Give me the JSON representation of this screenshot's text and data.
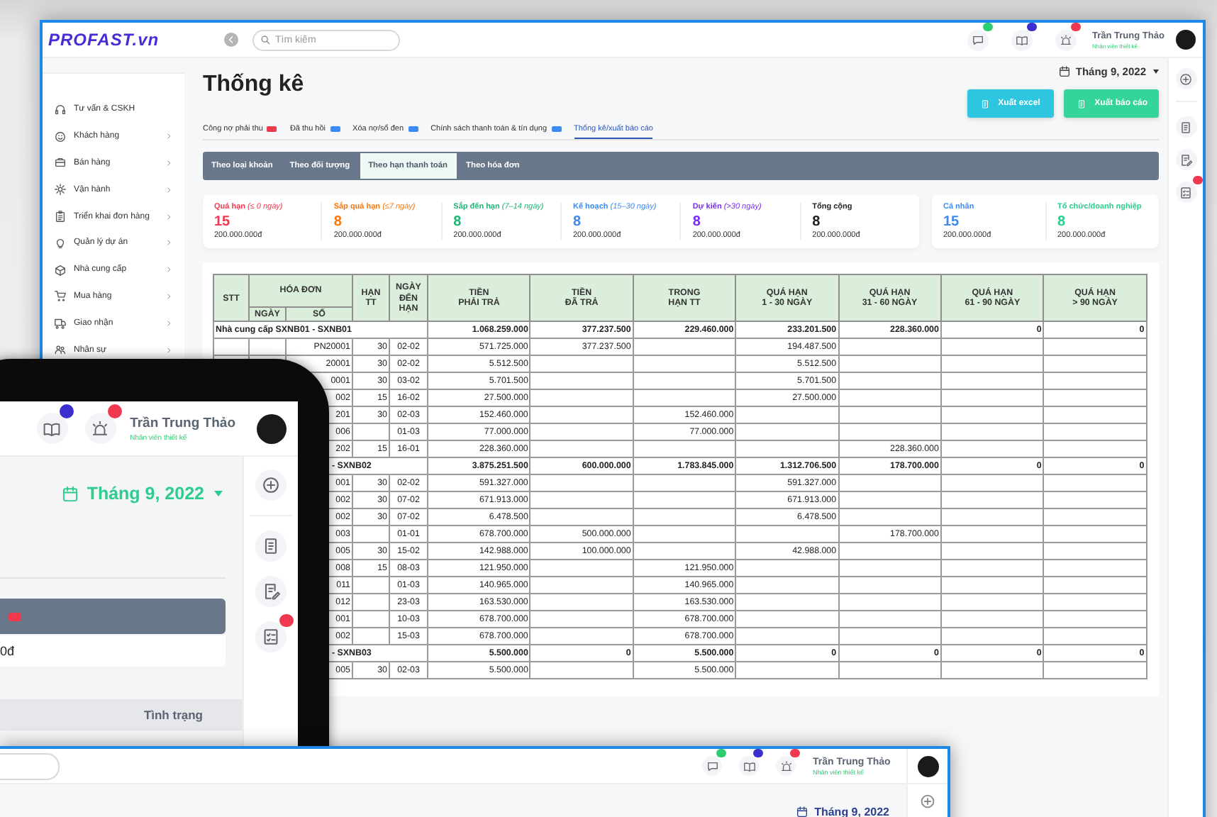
{
  "main_window": {
    "logo": "PROFAST.vn",
    "search": {
      "placeholder": "Tìm kiếm"
    },
    "notifications": [
      {
        "kind": "chat",
        "color": "#2ecc71"
      },
      {
        "kind": "book",
        "color": "#3b2fd0"
      },
      {
        "kind": "siren",
        "color": "#f0384f"
      }
    ],
    "user": {
      "name": "Trần Trung Thảo",
      "role": "Nhân viên thiết kế"
    },
    "sidebar": {
      "items": [
        {
          "label": "Tư vấn & CSKH",
          "has_submenu": false
        },
        {
          "label": "Khách hàng",
          "has_submenu": true
        },
        {
          "label": "Bán hàng",
          "has_submenu": true
        },
        {
          "label": "Vận hành",
          "has_submenu": true
        },
        {
          "label": "Triển khai đơn hàng",
          "has_submenu": true
        },
        {
          "label": "Quản lý dự án",
          "has_submenu": true
        },
        {
          "label": "Nhà cung cấp",
          "has_submenu": true
        },
        {
          "label": "Mua hàng",
          "has_submenu": true
        },
        {
          "label": "Giao nhận",
          "has_submenu": true
        },
        {
          "label": "Nhân sự",
          "has_submenu": true
        }
      ]
    },
    "page_title": "Thống kê",
    "period": "Tháng 9, 2022",
    "buttons": [
      {
        "label": "Xuất excel",
        "color": "#2ec5e0"
      },
      {
        "label": "Xuất báo cáo",
        "color": "#35d49b"
      }
    ],
    "tabs": [
      {
        "label": "Công nợ phải thu",
        "color": "#f0384f",
        "selected": false
      },
      {
        "label": "Đã thu hồi",
        "color": "#3d8bf2",
        "selected": false
      },
      {
        "label": "Xóa nợ/sổ đen",
        "color": "#3d8bf2",
        "selected": false
      },
      {
        "label": "Chính sách thanh toán & tín dụng",
        "color": "#3d8bf2",
        "selected": false
      },
      {
        "label": "Thống kê/xuất báo cáo",
        "selected": true
      }
    ],
    "segments": [
      {
        "label": "Theo loại khoản",
        "selected": false
      },
      {
        "label": "Theo đối tượng",
        "selected": false
      },
      {
        "label": "Theo hạn thanh toán",
        "selected": true
      },
      {
        "label": "Theo hóa đơn",
        "selected": false
      }
    ],
    "summary_cards": [
      [
        {
          "label": "Quá hạn *(≤ 0 ngày)*",
          "color": "#f0384f",
          "count": "15",
          "amount": "200.000.000đ"
        },
        {
          "label": "Sắp quá hạn *(≤7 ngày)*",
          "color": "#f7780f",
          "count": "8",
          "amount": "200.000.000đ"
        },
        {
          "label": "Sắp đến hạn *(7–14 ngày)*",
          "color": "#22b573",
          "count": "8",
          "amount": "200.000.000đ"
        },
        {
          "label": "Kế hoạch *(15–30 ngày)*",
          "color": "#3d8bf2",
          "count": "8",
          "amount": "200.000.000đ"
        },
        {
          "label": "Dự kiến *(>30 ngày)*",
          "color": "#7a2ff0",
          "count": "8",
          "amount": "200.000.000đ"
        },
        {
          "label": "Tổng cộng",
          "color": "#222222",
          "count": "8",
          "amount": "200.000.000đ"
        }
      ],
      [
        {
          "label": "Cá nhân",
          "color": "#3d8bf2",
          "count": "15",
          "amount": "200.000.000đ"
        },
        {
          "label": "Tổ chức/doanh nghiệp",
          "color": "#2ecc8f",
          "count": "8",
          "amount": "200.000.000đ"
        }
      ]
    ],
    "rail": [
      {
        "kind": "add",
        "badge": false
      },
      {
        "kind": "document",
        "badge": false
      },
      {
        "kind": "edit",
        "badge": false
      },
      {
        "kind": "checklist",
        "badge": true
      }
    ],
    "table": {
      "header": {
        "stt": "STT",
        "invoice": "HÓA ĐƠN",
        "invoice_parts": [
          "NGÀY",
          "SỐ"
        ],
        "columns": [
          "HẠN\nTT",
          "NGÀY\nĐẾN\nHẠN",
          "TIỀN\nPHẢI TRẢ",
          "TIỀN\nĐÃ TRẢ",
          "TRONG\nHẠN TT",
          "QUÁ HẠN\n1 - 30 NGÀY",
          "QUÁ HẠN\n31 - 60 NGÀY",
          "QUÁ HẠN\n61 - 90 NGÀY",
          "QUÁ HẠN\n> 90 NGÀY"
        ]
      },
      "rows": [
        {
          "kind": "group",
          "label": "Nhà cung cấp SXNB01 - SXNB01",
          "to_pay": "1.068.259.000",
          "paid": "377.237.500",
          "in_term": "229.460.000",
          "overdue_1_30": "233.201.500",
          "overdue_31_60": "228.360.000",
          "overdue_61_90": "0",
          "overdue_over_90": "0"
        },
        {
          "kind": "item",
          "number": "PN20001",
          "term": "30",
          "due": "02-02",
          "to_pay": "571.725.000",
          "paid": "377.237.500",
          "overdue_1_30": "194.487.500"
        },
        {
          "kind": "item",
          "number": "20001",
          "term": "30",
          "due": "02-02",
          "to_pay": "5.512.500",
          "overdue_1_30": "5.512.500"
        },
        {
          "kind": "item",
          "number": "0001",
          "term": "30",
          "due": "03-02",
          "to_pay": "5.701.500",
          "overdue_1_30": "5.701.500"
        },
        {
          "kind": "item",
          "number": "002",
          "term": "15",
          "due": "16-02",
          "to_pay": "27.500.000",
          "overdue_1_30": "27.500.000"
        },
        {
          "kind": "item",
          "number": "201",
          "term": "30",
          "due": "02-03",
          "to_pay": "152.460.000",
          "in_term": "152.460.000"
        },
        {
          "kind": "item",
          "number": "006",
          "due": "01-03",
          "to_pay": "77.000.000",
          "in_term": "77.000.000"
        },
        {
          "kind": "item",
          "number": "202",
          "term": "15",
          "due": "16-01",
          "to_pay": "228.360.000",
          "overdue_31_60": "228.360.000"
        },
        {
          "kind": "group",
          "label": "- SXNB02",
          "to_pay": "3.875.251.500",
          "paid": "600.000.000",
          "in_term": "1.783.845.000",
          "overdue_1_30": "1.312.706.500",
          "overdue_31_60": "178.700.000",
          "overdue_61_90": "0",
          "overdue_over_90": "0"
        },
        {
          "kind": "item",
          "number": "001",
          "term": "30",
          "due": "02-02",
          "to_pay": "591.327.000",
          "overdue_1_30": "591.327.000"
        },
        {
          "kind": "item",
          "number": "002",
          "term": "30",
          "due": "07-02",
          "to_pay": "671.913.000",
          "overdue_1_30": "671.913.000"
        },
        {
          "kind": "item",
          "number": "002",
          "term": "30",
          "due": "07-02",
          "to_pay": "6.478.500",
          "overdue_1_30": "6.478.500"
        },
        {
          "kind": "item",
          "number": "003",
          "due": "01-01",
          "to_pay": "678.700.000",
          "paid": "500.000.000",
          "overdue_31_60": "178.700.000"
        },
        {
          "kind": "item",
          "number": "005",
          "term": "30",
          "due": "15-02",
          "to_pay": "142.988.000",
          "paid": "100.000.000",
          "overdue_1_30": "42.988.000"
        },
        {
          "kind": "item",
          "number": "008",
          "term": "15",
          "due": "08-03",
          "to_pay": "121.950.000",
          "in_term": "121.950.000"
        },
        {
          "kind": "item",
          "number": "011",
          "due": "01-03",
          "to_pay": "140.965.000",
          "in_term": "140.965.000"
        },
        {
          "kind": "item",
          "number": "012",
          "due": "23-03",
          "to_pay": "163.530.000",
          "in_term": "163.530.000"
        },
        {
          "kind": "item",
          "number": "001",
          "due": "10-03",
          "to_pay": "678.700.000",
          "in_term": "678.700.000"
        },
        {
          "kind": "item",
          "number": "002",
          "due": "15-03",
          "to_pay": "678.700.000",
          "in_term": "678.700.000"
        },
        {
          "kind": "group",
          "label": "- SXNB03",
          "to_pay": "5.500.000",
          "paid": "0",
          "in_term": "5.500.000",
          "overdue_1_30": "0",
          "overdue_31_60": "0",
          "overdue_61_90": "0",
          "overdue_over_90": "0"
        },
        {
          "kind": "item",
          "number": "005",
          "term": "30",
          "due": "02-03",
          "to_pay": "5.500.000",
          "in_term": "5.500.000"
        }
      ]
    }
  },
  "tablet": {
    "notifications": [
      {
        "kind": "book",
        "color": "#3b2fd0"
      },
      {
        "kind": "siren",
        "color": "#f0384f"
      }
    ],
    "user": {
      "name": "Trần Trung Thảo",
      "role": "Nhân viên thiết kế"
    },
    "period": "Tháng 9, 2022",
    "amount": "0đ",
    "column_label": "Tình trạng",
    "rail": [
      {
        "kind": "add",
        "badge": false
      },
      {
        "kind": "document",
        "badge": false
      },
      {
        "kind": "edit",
        "badge": false
      },
      {
        "kind": "checklist",
        "badge": true
      }
    ]
  },
  "bottom_window": {
    "notifications": [
      {
        "kind": "chat",
        "color": "#2ecc71"
      },
      {
        "kind": "book",
        "color": "#3b2fd0"
      },
      {
        "kind": "siren",
        "color": "#f0384f"
      }
    ],
    "user": {
      "name": "Trần Trung Thảo",
      "role": "Nhân viên thiết kế"
    },
    "period": "Tháng 9, 2022"
  }
}
